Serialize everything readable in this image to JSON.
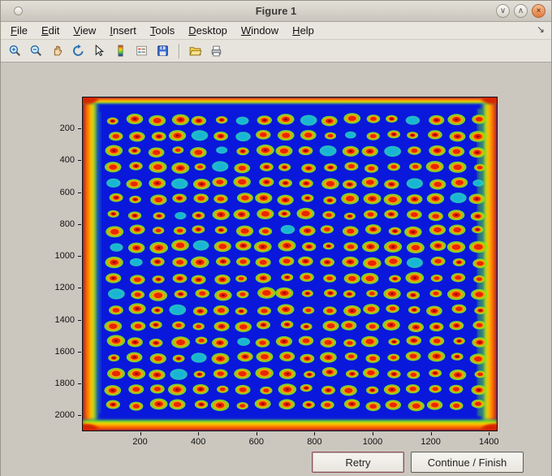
{
  "window": {
    "title": "Figure 1",
    "controls": [
      {
        "name": "minimize",
        "glyph": "∨"
      },
      {
        "name": "maximize",
        "glyph": "∧"
      },
      {
        "name": "close",
        "glyph": "×"
      }
    ]
  },
  "menubar": {
    "items": [
      "File",
      "Edit",
      "View",
      "Insert",
      "Tools",
      "Desktop",
      "Window",
      "Help"
    ],
    "dock_icon": "↘"
  },
  "toolbar": {
    "buttons": [
      "zoom-in",
      "zoom-out",
      "pan",
      "rotate-3d",
      "data-cursor",
      "colorbar",
      "insert-legend",
      "save",
      "separator",
      "open",
      "print"
    ]
  },
  "action_buttons": {
    "retry": "Retry",
    "continue": "Continue / Finish"
  },
  "chart_data": {
    "type": "heatmap",
    "title": "",
    "description": "Jet-colormap intensity image of a microarray/plate scan: regular grid of warm (red/orange, yellow-green halo) spots on a deep blue background, with saturated red/orange/yellow/green bands along all four image edges",
    "colormap": "jet",
    "x_range": [
      0,
      1430
    ],
    "y_range": [
      0,
      2100
    ],
    "xticks": [
      200,
      400,
      600,
      800,
      1000,
      1200,
      1400
    ],
    "yticks": [
      200,
      400,
      600,
      800,
      1000,
      1200,
      1400,
      1600,
      1800,
      2000
    ],
    "grid": {
      "rows": 19,
      "cols": 18,
      "x_start": 110,
      "x_step": 74,
      "y_start": 140,
      "y_step": 100
    },
    "colors": {
      "background": "#0a18dc",
      "edge_red": "#d62300",
      "edge_orange": "#ff7300",
      "edge_yellow": "#ffd400",
      "edge_green": "#4fdc1e",
      "spot_halo": "#8ae516",
      "spot_mid": "#ffa000",
      "spot_core": "#e82600",
      "spot_dark_core": "#9e0010",
      "cool_spot": "#27d8c0"
    }
  }
}
